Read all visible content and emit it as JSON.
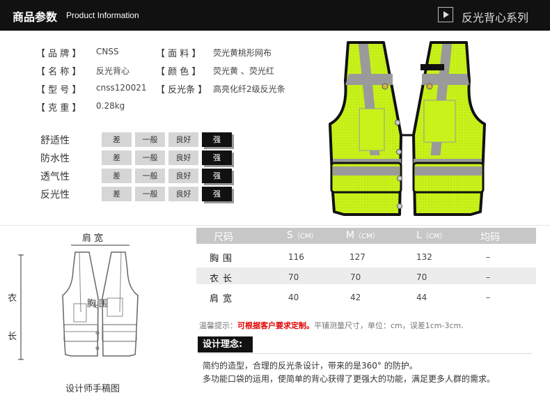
{
  "header": {
    "title_cn": "商品参数",
    "title_en": "Product Information",
    "series": "反光背心系列"
  },
  "specs": [
    {
      "label": "【 品    牌 】",
      "value": "CNSS"
    },
    {
      "label": "【 名    称 】",
      "value": "反光背心"
    },
    {
      "label": "【 型    号 】",
      "value": "cnss120021"
    },
    {
      "label": "【 克    重 】",
      "value": "0.28kg"
    },
    {
      "label": "【 面    料 】",
      "value": "荧光黄桃形网布"
    },
    {
      "label": "【 颜    色 】",
      "value": "荧光黄 、荧光红"
    },
    {
      "label": "【 反光条 】",
      "value": "高亮化纤2级反光条"
    }
  ],
  "ratings": {
    "levels": [
      "差",
      "一般",
      "良好",
      "强"
    ],
    "items": [
      {
        "label": "舒适性",
        "selected": 3
      },
      {
        "label": "防水性",
        "selected": 3
      },
      {
        "label": "透气性",
        "selected": 3
      },
      {
        "label": "反光性",
        "selected": 3
      }
    ]
  },
  "size_table": {
    "headers": {
      "size": "尺码",
      "s": "S",
      "m": "M",
      "l": "L",
      "unit": "（CM）",
      "free": "均码"
    },
    "rows": [
      {
        "label": "胸围",
        "s": "116",
        "m": "127",
        "l": "132",
        "free": "–"
      },
      {
        "label": "衣长",
        "s": "70",
        "m": "70",
        "l": "70",
        "free": "–"
      },
      {
        "label": "肩宽",
        "s": "40",
        "m": "42",
        "l": "44",
        "free": "–"
      }
    ]
  },
  "note": {
    "prefix": "温馨提示：",
    "highlight": "可根据客户要求定制。",
    "suffix": "平铺测量尺寸，单位：cm，误差1cm-3cm."
  },
  "concept": {
    "title": "设计理念:",
    "line1": "简约的造型，合理的反光条设计，带来的是360° 的防护。",
    "line2": "多功能口袋的运用，使简单的背心获得了更强大的功能，满足更多人群的需求。"
  },
  "sketch": {
    "shoulder_label": "肩  宽",
    "chest_label": "胸  围",
    "length_label_1": "衣",
    "length_label_2": "长",
    "caption": "设计师手稿图"
  },
  "colors": {
    "vest": "#c8f21a",
    "trim": "#111111",
    "reflective": "#9a9a9a",
    "header_bg": "#111111",
    "highlight_red": "#e00000"
  }
}
